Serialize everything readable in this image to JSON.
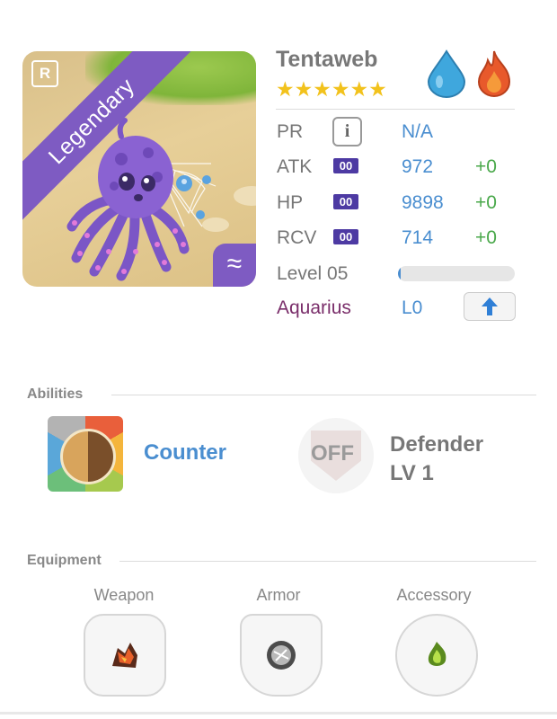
{
  "monster": {
    "name": "Tentaweb",
    "rarity": "Legendary",
    "rarity_badge": "R",
    "stars": "★★★★★★",
    "star_count": 6,
    "element_icons": [
      "water-drop-icon",
      "fire-icon"
    ],
    "corner_symbol": "≈"
  },
  "stats": {
    "pr": {
      "label": "PR",
      "info": "i",
      "value": "N/A"
    },
    "atk": {
      "label": "ATK",
      "badge": "00",
      "value": "972",
      "bonus": "+0"
    },
    "hp": {
      "label": "HP",
      "badge": "00",
      "value": "9898",
      "bonus": "+0"
    },
    "rcv": {
      "label": "RCV",
      "badge": "00",
      "value": "714",
      "bonus": "+0"
    },
    "level": {
      "label": "Level 05",
      "progress": 0.02
    },
    "sign": {
      "label": "Aquarius",
      "value": "L0",
      "upgrade_icon": "up-arrow-icon"
    }
  },
  "abilities": {
    "title": "Abilities",
    "active": {
      "name": "Counter",
      "icon": "cat-face-icon"
    },
    "passive": {
      "status": "OFF",
      "line1": "Defender",
      "line2": "LV 1",
      "icon": "shield-icon"
    }
  },
  "equipment": {
    "title": "Equipment",
    "slots": [
      {
        "label": "Weapon",
        "icon": "lava-rock-icon"
      },
      {
        "label": "Armor",
        "icon": "silver-orb-icon"
      },
      {
        "label": "Accessory",
        "icon": "green-gem-icon"
      }
    ]
  },
  "colors": {
    "accent_blue": "#4a8ed0",
    "bonus_green": "#49a84a",
    "legendary_purple": "#7e5bc2",
    "aquarius_purple": "#7a2e6a",
    "star_gold": "#f2c21c"
  }
}
